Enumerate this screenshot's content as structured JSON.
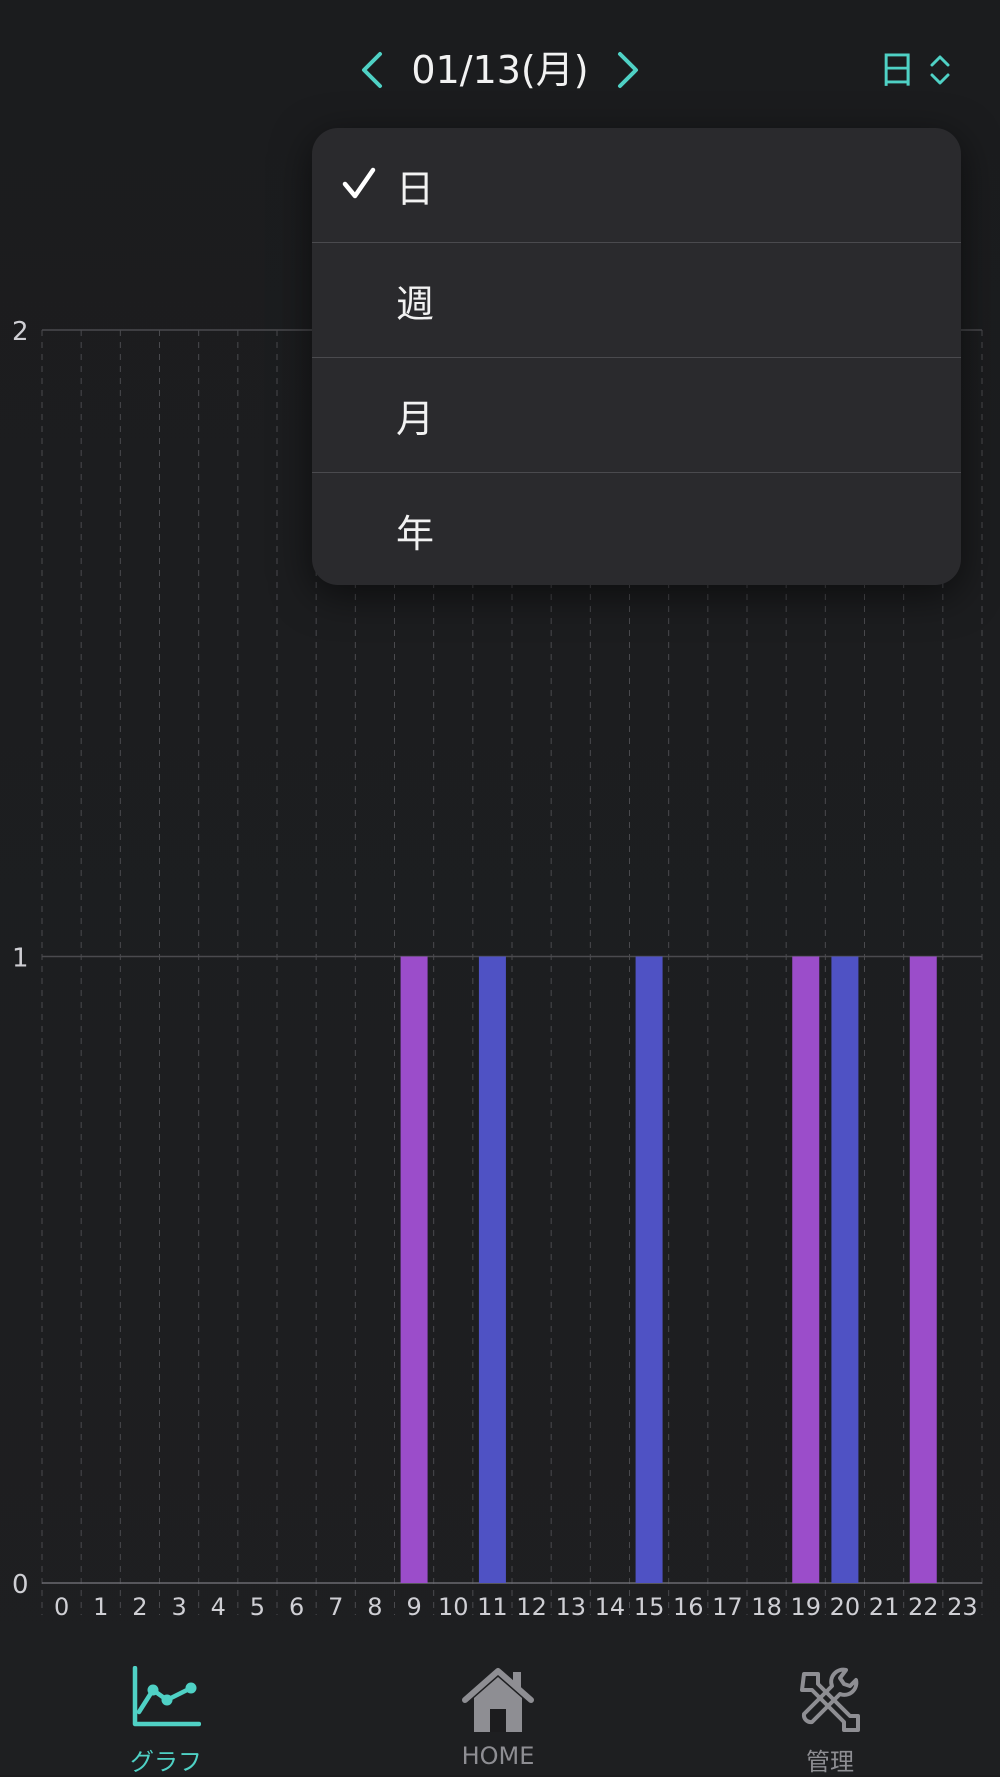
{
  "header": {
    "date": "01/13(月)",
    "mode": "日"
  },
  "dropdown": {
    "selected": "日",
    "options": [
      "日",
      "週",
      "月",
      "年"
    ]
  },
  "colors": {
    "accent": "#4fd1c5",
    "series_purple": "#9b4dca",
    "series_blue": "#4f52c4"
  },
  "tabs": {
    "graph": "グラフ",
    "home": "HOME",
    "admin": "管理"
  },
  "chart_data": {
    "type": "bar",
    "categories": [
      "0",
      "1",
      "2",
      "3",
      "4",
      "5",
      "6",
      "7",
      "8",
      "9",
      "10",
      "11",
      "12",
      "13",
      "14",
      "15",
      "16",
      "17",
      "18",
      "19",
      "20",
      "21",
      "22",
      "23"
    ],
    "ylim": [
      0,
      2
    ],
    "yticks": [
      "0",
      "1",
      "2"
    ],
    "grid": true,
    "series": [
      {
        "values": [
          0,
          0,
          0,
          0,
          0,
          0,
          0,
          0,
          0,
          1,
          0,
          0,
          0,
          0,
          0,
          0,
          0,
          0,
          0,
          1,
          0,
          0,
          1,
          0
        ],
        "color": "#9b4dca"
      },
      {
        "values": [
          0,
          0,
          0,
          0,
          0,
          0,
          0,
          0,
          0,
          0,
          0,
          1,
          0,
          0,
          0,
          1,
          0,
          0,
          0,
          0,
          1,
          0,
          0,
          0
        ],
        "color": "#4f52c4"
      }
    ]
  }
}
